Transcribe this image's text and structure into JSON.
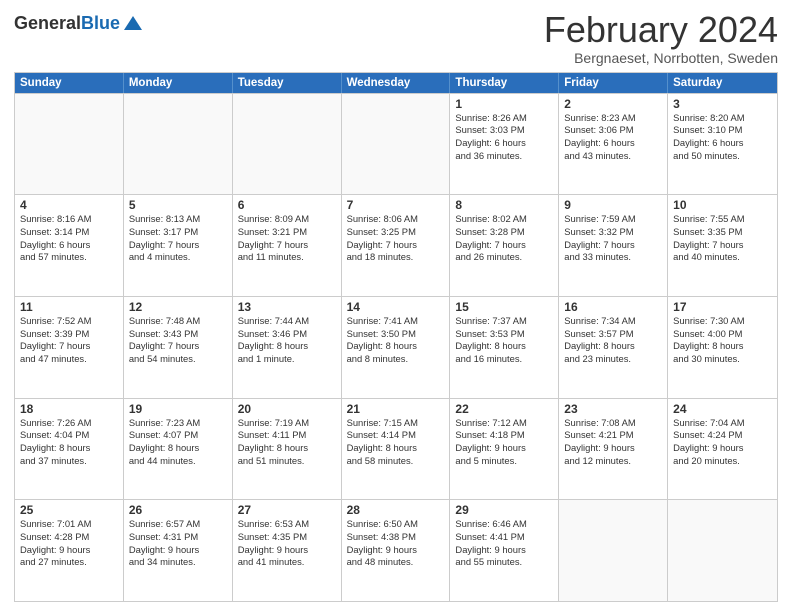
{
  "header": {
    "logo_general": "General",
    "logo_blue": "Blue",
    "month": "February 2024",
    "location": "Bergnaeset, Norrbotten, Sweden"
  },
  "days_of_week": [
    "Sunday",
    "Monday",
    "Tuesday",
    "Wednesday",
    "Thursday",
    "Friday",
    "Saturday"
  ],
  "weeks": [
    [
      {
        "day": "",
        "empty": true
      },
      {
        "day": "",
        "empty": true
      },
      {
        "day": "",
        "empty": true
      },
      {
        "day": "",
        "empty": true
      },
      {
        "day": "1",
        "lines": [
          "Sunrise: 8:26 AM",
          "Sunset: 3:03 PM",
          "Daylight: 6 hours",
          "and 36 minutes."
        ]
      },
      {
        "day": "2",
        "lines": [
          "Sunrise: 8:23 AM",
          "Sunset: 3:06 PM",
          "Daylight: 6 hours",
          "and 43 minutes."
        ]
      },
      {
        "day": "3",
        "lines": [
          "Sunrise: 8:20 AM",
          "Sunset: 3:10 PM",
          "Daylight: 6 hours",
          "and 50 minutes."
        ]
      }
    ],
    [
      {
        "day": "4",
        "lines": [
          "Sunrise: 8:16 AM",
          "Sunset: 3:14 PM",
          "Daylight: 6 hours",
          "and 57 minutes."
        ]
      },
      {
        "day": "5",
        "lines": [
          "Sunrise: 8:13 AM",
          "Sunset: 3:17 PM",
          "Daylight: 7 hours",
          "and 4 minutes."
        ]
      },
      {
        "day": "6",
        "lines": [
          "Sunrise: 8:09 AM",
          "Sunset: 3:21 PM",
          "Daylight: 7 hours",
          "and 11 minutes."
        ]
      },
      {
        "day": "7",
        "lines": [
          "Sunrise: 8:06 AM",
          "Sunset: 3:25 PM",
          "Daylight: 7 hours",
          "and 18 minutes."
        ]
      },
      {
        "day": "8",
        "lines": [
          "Sunrise: 8:02 AM",
          "Sunset: 3:28 PM",
          "Daylight: 7 hours",
          "and 26 minutes."
        ]
      },
      {
        "day": "9",
        "lines": [
          "Sunrise: 7:59 AM",
          "Sunset: 3:32 PM",
          "Daylight: 7 hours",
          "and 33 minutes."
        ]
      },
      {
        "day": "10",
        "lines": [
          "Sunrise: 7:55 AM",
          "Sunset: 3:35 PM",
          "Daylight: 7 hours",
          "and 40 minutes."
        ]
      }
    ],
    [
      {
        "day": "11",
        "lines": [
          "Sunrise: 7:52 AM",
          "Sunset: 3:39 PM",
          "Daylight: 7 hours",
          "and 47 minutes."
        ]
      },
      {
        "day": "12",
        "lines": [
          "Sunrise: 7:48 AM",
          "Sunset: 3:43 PM",
          "Daylight: 7 hours",
          "and 54 minutes."
        ]
      },
      {
        "day": "13",
        "lines": [
          "Sunrise: 7:44 AM",
          "Sunset: 3:46 PM",
          "Daylight: 8 hours",
          "and 1 minute."
        ]
      },
      {
        "day": "14",
        "lines": [
          "Sunrise: 7:41 AM",
          "Sunset: 3:50 PM",
          "Daylight: 8 hours",
          "and 8 minutes."
        ]
      },
      {
        "day": "15",
        "lines": [
          "Sunrise: 7:37 AM",
          "Sunset: 3:53 PM",
          "Daylight: 8 hours",
          "and 16 minutes."
        ]
      },
      {
        "day": "16",
        "lines": [
          "Sunrise: 7:34 AM",
          "Sunset: 3:57 PM",
          "Daylight: 8 hours",
          "and 23 minutes."
        ]
      },
      {
        "day": "17",
        "lines": [
          "Sunrise: 7:30 AM",
          "Sunset: 4:00 PM",
          "Daylight: 8 hours",
          "and 30 minutes."
        ]
      }
    ],
    [
      {
        "day": "18",
        "lines": [
          "Sunrise: 7:26 AM",
          "Sunset: 4:04 PM",
          "Daylight: 8 hours",
          "and 37 minutes."
        ]
      },
      {
        "day": "19",
        "lines": [
          "Sunrise: 7:23 AM",
          "Sunset: 4:07 PM",
          "Daylight: 8 hours",
          "and 44 minutes."
        ]
      },
      {
        "day": "20",
        "lines": [
          "Sunrise: 7:19 AM",
          "Sunset: 4:11 PM",
          "Daylight: 8 hours",
          "and 51 minutes."
        ]
      },
      {
        "day": "21",
        "lines": [
          "Sunrise: 7:15 AM",
          "Sunset: 4:14 PM",
          "Daylight: 8 hours",
          "and 58 minutes."
        ]
      },
      {
        "day": "22",
        "lines": [
          "Sunrise: 7:12 AM",
          "Sunset: 4:18 PM",
          "Daylight: 9 hours",
          "and 5 minutes."
        ]
      },
      {
        "day": "23",
        "lines": [
          "Sunrise: 7:08 AM",
          "Sunset: 4:21 PM",
          "Daylight: 9 hours",
          "and 12 minutes."
        ]
      },
      {
        "day": "24",
        "lines": [
          "Sunrise: 7:04 AM",
          "Sunset: 4:24 PM",
          "Daylight: 9 hours",
          "and 20 minutes."
        ]
      }
    ],
    [
      {
        "day": "25",
        "lines": [
          "Sunrise: 7:01 AM",
          "Sunset: 4:28 PM",
          "Daylight: 9 hours",
          "and 27 minutes."
        ]
      },
      {
        "day": "26",
        "lines": [
          "Sunrise: 6:57 AM",
          "Sunset: 4:31 PM",
          "Daylight: 9 hours",
          "and 34 minutes."
        ]
      },
      {
        "day": "27",
        "lines": [
          "Sunrise: 6:53 AM",
          "Sunset: 4:35 PM",
          "Daylight: 9 hours",
          "and 41 minutes."
        ]
      },
      {
        "day": "28",
        "lines": [
          "Sunrise: 6:50 AM",
          "Sunset: 4:38 PM",
          "Daylight: 9 hours",
          "and 48 minutes."
        ]
      },
      {
        "day": "29",
        "lines": [
          "Sunrise: 6:46 AM",
          "Sunset: 4:41 PM",
          "Daylight: 9 hours",
          "and 55 minutes."
        ]
      },
      {
        "day": "",
        "empty": true
      },
      {
        "day": "",
        "empty": true
      }
    ]
  ]
}
